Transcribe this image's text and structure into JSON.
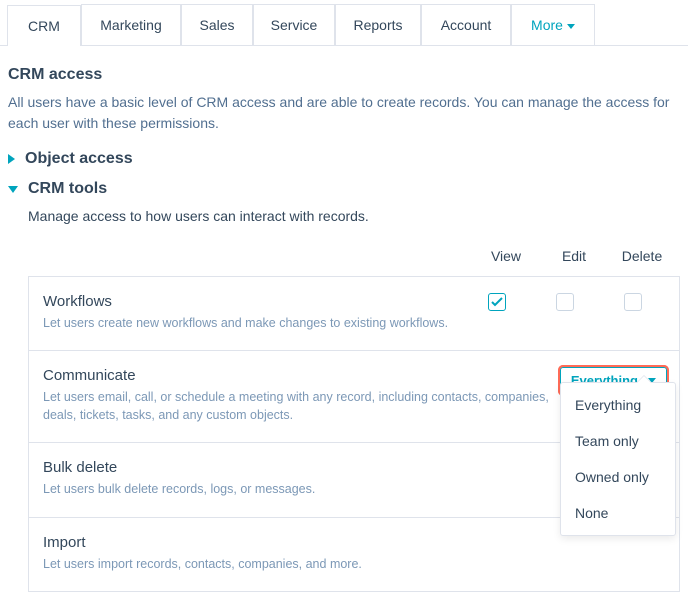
{
  "tabs": [
    "CRM",
    "Marketing",
    "Sales",
    "Service",
    "Reports",
    "Account",
    "More"
  ],
  "crm_access": {
    "title": "CRM access",
    "desc": "All users have a basic level of CRM access and are able to create records. You can manage the access for each user with these permissions."
  },
  "object_access_title": "Object access",
  "crm_tools": {
    "title": "CRM tools",
    "desc": "Manage access to how users can interact with records."
  },
  "columns": [
    "View",
    "Edit",
    "Delete"
  ],
  "rows": [
    {
      "title": "Workflows",
      "sub": "Let users create new workflows and make changes to existing workflows."
    },
    {
      "title": "Communicate",
      "sub": "Let users email, call, or schedule a meeting with any record, including contacts, companies, deals, tickets, tasks, and any custom objects."
    },
    {
      "title": "Bulk delete",
      "sub": "Let users bulk delete records, logs, or messages."
    },
    {
      "title": "Import",
      "sub": "Let users import records, contacts, companies, and more."
    }
  ],
  "dropdown": {
    "label": "Everything",
    "options": [
      "Everything",
      "Team only",
      "Owned only",
      "None"
    ]
  }
}
